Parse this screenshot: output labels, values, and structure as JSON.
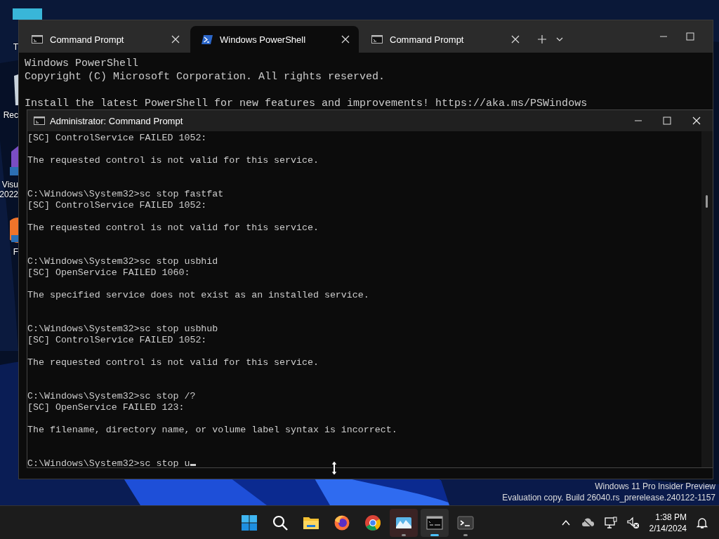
{
  "desktop_icons": [
    {
      "kind": "folder",
      "lines": [
        "T"
      ]
    },
    {
      "kind": "recycle",
      "lines": [
        "Rec"
      ]
    },
    {
      "kind": "studio",
      "lines": [
        "Visu",
        "2022"
      ]
    },
    {
      "kind": "browser",
      "lines": [
        "F"
      ]
    }
  ],
  "terminal": {
    "tabs": [
      {
        "kind": "cmd",
        "label": "Command Prompt",
        "selected": false
      },
      {
        "kind": "powershell",
        "label": "Windows PowerShell",
        "selected": true
      },
      {
        "kind": "cmd",
        "label": "Command Prompt",
        "selected": false
      }
    ],
    "lines": [
      "Windows PowerShell",
      "Copyright (C) Microsoft Corporation. All rights reserved.",
      "Install the latest PowerShell for new features and improvements! https://aka.ms/PSWindows"
    ]
  },
  "cmd_window": {
    "title": "Administrator: Command Prompt",
    "entries": [
      {
        "output": [
          "[SC] ControlService FAILED 1052:",
          "The requested control is not valid for this service."
        ]
      },
      {
        "command": "C:\\Windows\\System32>sc stop fastfat",
        "output": [
          "[SC] ControlService FAILED 1052:",
          "The requested control is not valid for this service."
        ]
      },
      {
        "command": "C:\\Windows\\System32>sc stop usbhid",
        "output": [
          "[SC] OpenService FAILED 1060:",
          "The specified service does not exist as an installed service."
        ]
      },
      {
        "command": "C:\\Windows\\System32>sc stop usbhub",
        "output": [
          "[SC] ControlService FAILED 1052:",
          "The requested control is not valid for this service."
        ]
      },
      {
        "command": "C:\\Windows\\System32>sc stop /?",
        "output": [
          "[SC] OpenService FAILED 123:",
          "The filename, directory name, or volume label syntax is incorrect."
        ]
      },
      {
        "command": "C:\\Windows\\System32>sc stop u",
        "cursor": true
      }
    ]
  },
  "desktop_notice": [
    "Windows 11 Pro Insider Preview",
    "Evaluation copy. Build 26040.rs_prerelease.240122-1157"
  ],
  "taskbar": {
    "apps": [
      {
        "kind": "start",
        "running": false,
        "selected": false
      },
      {
        "kind": "search",
        "running": false,
        "selected": false
      },
      {
        "kind": "explorer",
        "running": false,
        "selected": false
      },
      {
        "kind": "firefox",
        "running": false,
        "selected": false
      },
      {
        "kind": "chrome",
        "running": false,
        "selected": false
      },
      {
        "kind": "photos",
        "running": true,
        "selected": false
      },
      {
        "kind": "cmd",
        "running": true,
        "selected": true
      },
      {
        "kind": "terminal",
        "running": true,
        "selected": false
      }
    ],
    "time": "1:38 PM",
    "date": "2/14/2024"
  }
}
